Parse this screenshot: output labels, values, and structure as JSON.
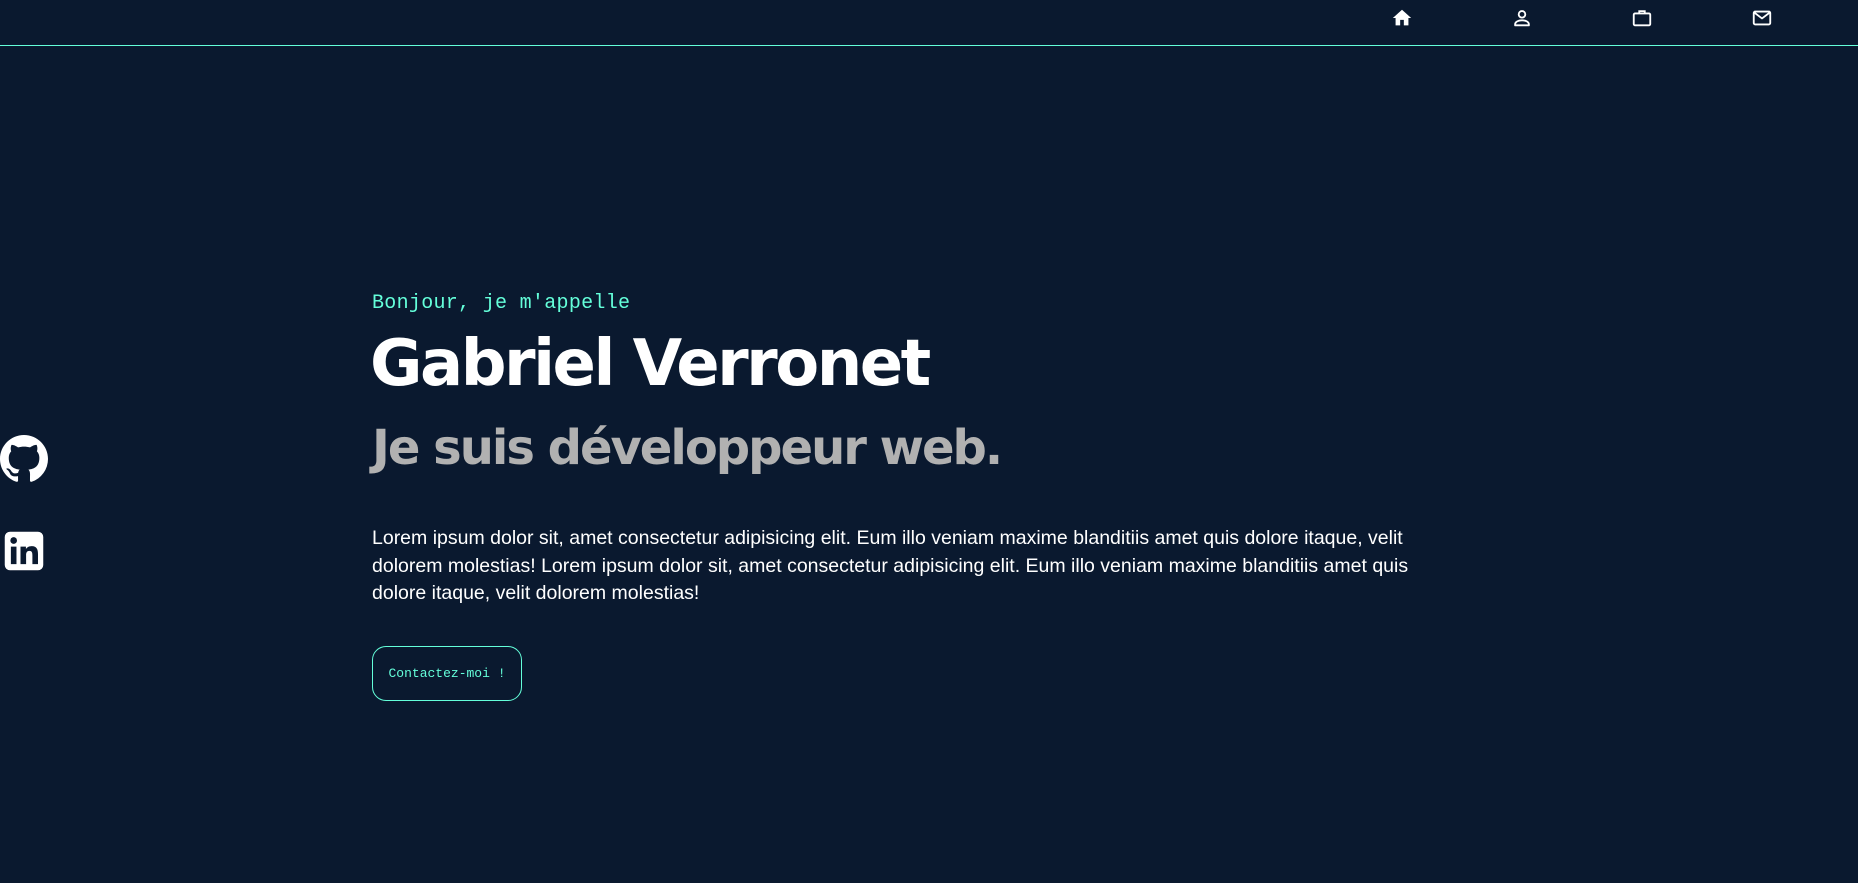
{
  "nav": {
    "items": [
      {
        "icon": "home-icon",
        "label": "Accueil"
      },
      {
        "icon": "user-icon",
        "label": "À propos"
      },
      {
        "icon": "briefcase-icon",
        "label": "Projets"
      },
      {
        "icon": "mail-icon",
        "label": "Contact"
      }
    ]
  },
  "social": {
    "items": [
      {
        "icon": "github-icon",
        "label": "GitHub"
      },
      {
        "icon": "linkedin-icon",
        "label": "LinkedIn"
      }
    ]
  },
  "hero": {
    "greeting": "Bonjour, je m'appelle",
    "name": "Gabriel Verronet",
    "subtitle": "Je suis développeur web.",
    "description": "Lorem ipsum dolor sit, amet consectetur adipisicing elit. Eum illo veniam maxime blanditiis amet quis dolore itaque, velit dolorem molestias! Lorem ipsum dolor sit, amet consectetur adipisicing elit. Eum illo veniam maxime blanditiis amet quis dolore itaque, velit dolorem molestias!",
    "cta_label": "Contactez-moi !"
  },
  "colors": {
    "background": "#0a192f",
    "accent": "#64ffda",
    "heading": "#ffffff",
    "subheading": "#b1b1b1"
  }
}
